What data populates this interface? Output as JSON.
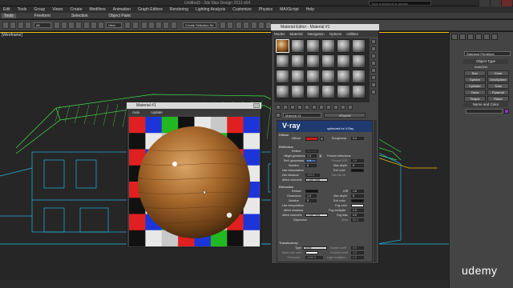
{
  "window": {
    "title": "Untitled3 - 3ds Max Design 2013 x64",
    "search_placeholder": "Type a keyword or phrase"
  },
  "menubar": [
    "Edit",
    "Tools",
    "Group",
    "Views",
    "Create",
    "Modifiers",
    "Animation",
    "Graph Editors",
    "Rendering",
    "Lighting Analysis",
    "Customize",
    "Physics",
    "MAXScript",
    "Help"
  ],
  "ribbon": {
    "tabs": [
      "Tools",
      "Freeform",
      "Selection",
      "Object Paint"
    ],
    "active": "Tools"
  },
  "toolbar": {
    "selection_filter": "All",
    "reference_coord": "View",
    "named_selection": "Create Selection Se"
  },
  "viewport": {
    "label": "[Wireframe]",
    "wire_color": "#22b5e0",
    "grid_color": "#48e04a",
    "highlight_color": "#f2c018"
  },
  "command_panel": {
    "dropdown": "Standard Primitives",
    "object_type_header": "Object Type",
    "autogrid": "AutoGrid",
    "buttons": [
      "Box",
      "Cone",
      "Sphere",
      "GeoSphere",
      "Cylinder",
      "Tube",
      "Torus",
      "Pyramid",
      "Teapot",
      "Plane"
    ],
    "name_color_header": "Name and Color"
  },
  "material_editor": {
    "title": "Material Editor - Material #1",
    "menu": [
      "Modes",
      "Material",
      "Navigation",
      "Options",
      "Utilities"
    ],
    "material_name": "Material #1",
    "material_type": "VRayMtl",
    "vray_tagline": "optimized for V-Ray",
    "diffuse_header": "Diffuse",
    "diffuse_label": "Diffuse",
    "roughness_label": "Roughness",
    "roughness_value": "0.0",
    "diffuse_color": "#d01818",
    "reflection_header": "Reflection",
    "reflection_params": {
      "reflect": "Reflect",
      "hilight_gloss": "Hilight glossiness",
      "hilight_value": "1.0",
      "lock": "L",
      "fresnel": "Fresnel reflections",
      "refl_gloss": "Refl. glossiness",
      "refl_value": "1.0",
      "fresnel_ior": "Fresnel IOR",
      "fresnel_ior_value": "1.6",
      "subdivs": "Subdivs",
      "subdivs_value": "8",
      "max_depth": "Max depth",
      "max_depth_value": "5",
      "use_interp": "Use interpolation",
      "exit_color": "Exit color",
      "dim_distance": "Dim distance",
      "dim_value": "100.0",
      "dim_falloff": "Dim fall off",
      "affect_channels": "Affect channels",
      "affect_value": "Color only"
    },
    "refraction_header": "Refraction",
    "refraction_params": {
      "refract": "Refract",
      "ior": "IOR",
      "ior_value": "1.6",
      "glossiness": "Glossiness",
      "gloss_value": "1.0",
      "max_depth": "Max depth",
      "max_depth_value": "5",
      "subdivs": "Subdivs",
      "subdivs_value": "8",
      "exit_color": "Exit color",
      "use_interp": "Use interpolation",
      "fog_color": "Fog color",
      "affect_shadows": "Affect shadows",
      "fog_multiplier": "Fog multiplier",
      "fog_mult_value": "1.0",
      "fog_bias": "Fog bias",
      "fog_bias_value": "0.0",
      "affect_channels": "Affect channels",
      "affect_value": "Color only",
      "dispersion": "Dispersion",
      "abbe": "Abbe",
      "abbe_value": "50.0"
    },
    "translucency_header": "Translucency",
    "translucency_params": {
      "type": "Type",
      "type_value": "None",
      "back_side_color": "Back-side color",
      "thickness": "Thickness",
      "thickness_value": "1000.0",
      "scatter_coeff": "Scatter coeff",
      "scatter_value": "0.0",
      "fwd_bck": "Fwd/bck coeff",
      "fwd_value": "1.0",
      "light_mult": "Light multiplier",
      "light_value": "1.0"
    }
  },
  "preview_window": {
    "title": "Material #1",
    "bar_items": [
      "Auto",
      "Update"
    ],
    "checker_colors": [
      "#e02020",
      "#1d35d8",
      "#22b822",
      "#111111",
      "#e8e8e8",
      "#c8c8c8"
    ]
  },
  "watermark": "udemy"
}
